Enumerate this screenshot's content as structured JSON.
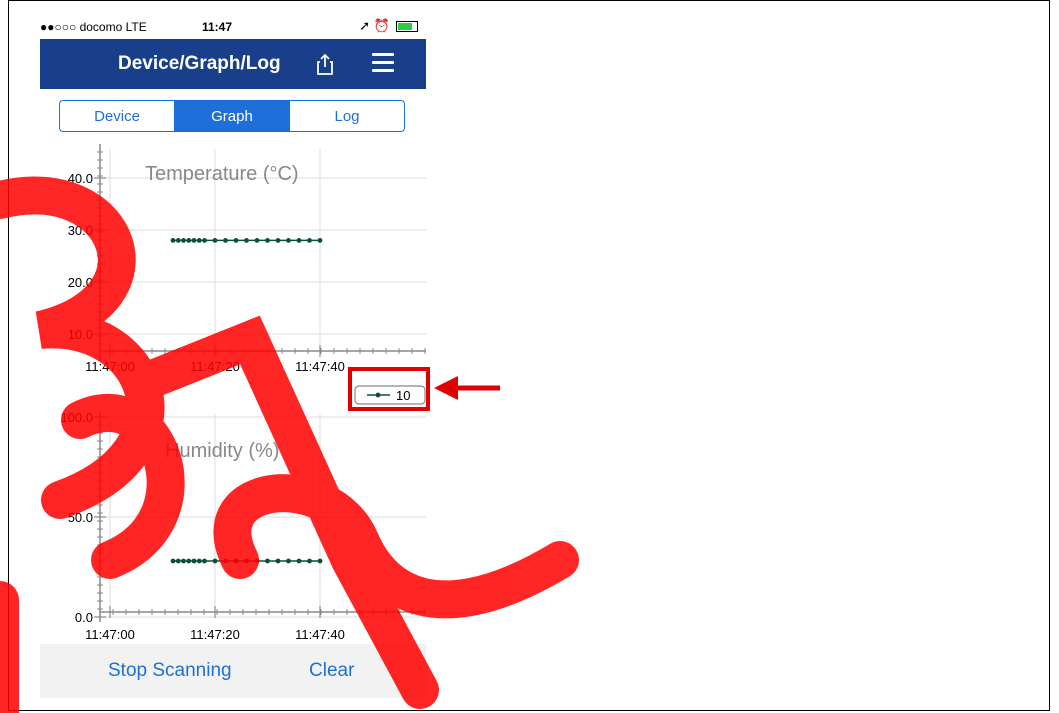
{
  "status_bar": {
    "carrier": "●●○○○ docomo  LTE",
    "time": "11:47",
    "indicators": "➚ ⏰"
  },
  "nav": {
    "title": "Device/Graph/Log",
    "share_icon": "share-icon",
    "menu_icon": "hamburger-menu-icon"
  },
  "tabs": [
    {
      "label": "Device",
      "active": false
    },
    {
      "label": "Graph",
      "active": true
    },
    {
      "label": "Log",
      "active": false
    }
  ],
  "legend": {
    "label": "10"
  },
  "chart_data": [
    {
      "type": "line",
      "title": "Temperature (°C)",
      "y_tick_labels": [
        "40.0",
        "30.0",
        "20.0",
        "10.0"
      ],
      "x_tick_labels": [
        "11:47:00",
        "11:47:20",
        "11:47:40"
      ],
      "ylim": [
        5,
        45
      ],
      "series": [
        {
          "name": "10",
          "x_seconds": [
            12,
            13,
            14,
            15,
            16,
            17,
            18,
            20,
            22,
            24,
            26,
            28,
            30,
            32,
            34,
            36,
            38,
            40
          ],
          "values": [
            28,
            28,
            28,
            28,
            28,
            28,
            28,
            28,
            28,
            28,
            28,
            28,
            28,
            28,
            28,
            28,
            28,
            28
          ]
        }
      ]
    },
    {
      "type": "line",
      "title": "Humidity (%)",
      "y_tick_labels": [
        "100.0",
        "50.0",
        "0.0"
      ],
      "x_tick_labels": [
        "11:47:00",
        "11:47:20",
        "11:47:40"
      ],
      "ylim": [
        0,
        100
      ],
      "series": [
        {
          "name": "10",
          "x_seconds": [
            12,
            13,
            14,
            15,
            16,
            17,
            18,
            20,
            22,
            24,
            26,
            28,
            30,
            32,
            34,
            36,
            38,
            40
          ],
          "values": [
            28,
            28,
            28,
            28,
            28,
            28,
            28,
            28,
            28,
            28,
            28,
            28,
            28,
            28,
            28,
            28,
            28,
            28
          ]
        }
      ]
    }
  ],
  "footer": {
    "stop_scanning": "Stop Scanning",
    "clear": "Clear"
  },
  "colors": {
    "nav_bg": "#1a3f8a",
    "accent": "#1e6fd9",
    "series": "#0d4f3c",
    "annotation": "#e00000",
    "watermark": "#ff0000"
  }
}
